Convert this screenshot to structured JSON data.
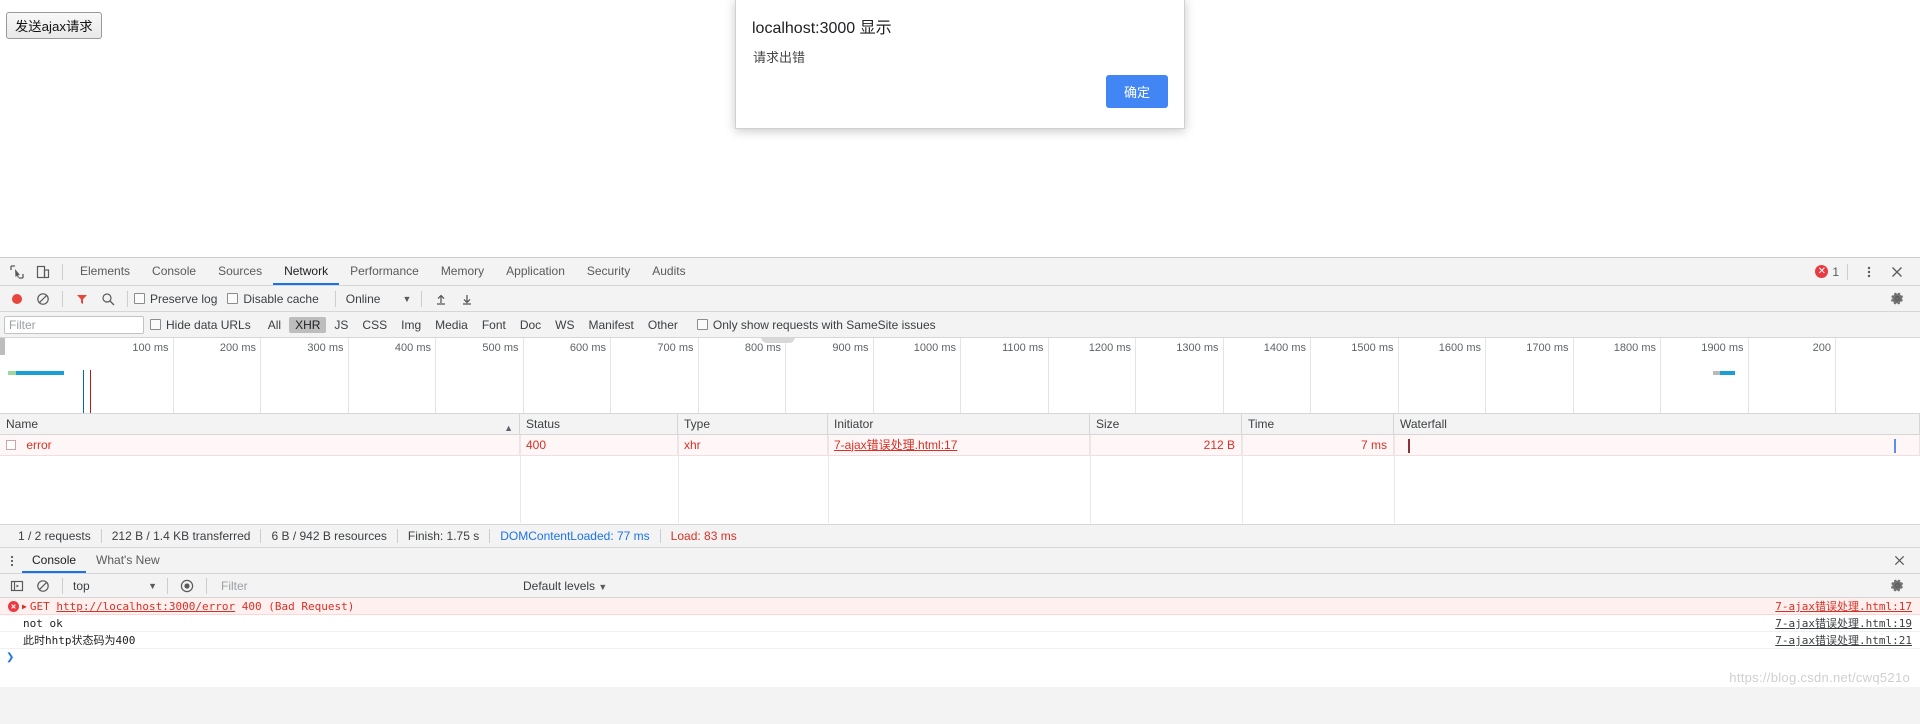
{
  "page": {
    "ajax_button_label": "发送ajax请求"
  },
  "dialog": {
    "origin_title": "localhost:3000 显示",
    "message": "请求出错",
    "ok_label": "确定",
    "accent": "#4285f4"
  },
  "devtools": {
    "tabs": [
      {
        "label": "Elements",
        "active": false
      },
      {
        "label": "Console",
        "active": false
      },
      {
        "label": "Sources",
        "active": false
      },
      {
        "label": "Network",
        "active": true
      },
      {
        "label": "Performance",
        "active": false
      },
      {
        "label": "Memory",
        "active": false
      },
      {
        "label": "Application",
        "active": false
      },
      {
        "label": "Security",
        "active": false
      },
      {
        "label": "Audits",
        "active": false
      }
    ],
    "error_count": "1",
    "icons": [
      "inspect-element-icon",
      "device-toolbar-icon",
      "more-options-icon",
      "close-icon"
    ]
  },
  "network_controls": {
    "preserve_log_label": "Preserve log",
    "preserve_log_checked": false,
    "disable_cache_label": "Disable cache",
    "disable_cache_checked": false,
    "throttling_value": "Online",
    "icons": [
      "record-icon",
      "clear-icon",
      "filter-icon",
      "search-icon",
      "import-har-icon",
      "export-har-icon",
      "settings-gear-icon"
    ]
  },
  "network_filter": {
    "filter_placeholder": "Filter",
    "filter_value": "",
    "hide_data_urls_label": "Hide data URLs",
    "hide_data_urls_checked": false,
    "type_chips": [
      {
        "label": "All",
        "active": false
      },
      {
        "label": "XHR",
        "active": true
      },
      {
        "label": "JS",
        "active": false
      },
      {
        "label": "CSS",
        "active": false
      },
      {
        "label": "Img",
        "active": false
      },
      {
        "label": "Media",
        "active": false
      },
      {
        "label": "Font",
        "active": false
      },
      {
        "label": "Doc",
        "active": false
      },
      {
        "label": "WS",
        "active": false
      },
      {
        "label": "Manifest",
        "active": false
      },
      {
        "label": "Other",
        "active": false
      }
    ],
    "samesite_label": "Only show requests with SameSite issues",
    "samesite_checked": false
  },
  "timeline": {
    "ticks": [
      "100 ms",
      "200 ms",
      "300 ms",
      "400 ms",
      "500 ms",
      "600 ms",
      "700 ms",
      "800 ms",
      "900 ms",
      "1000 ms",
      "1100 ms",
      "1200 ms",
      "1300 ms",
      "1400 ms",
      "1500 ms",
      "1600 ms",
      "1700 ms",
      "1800 ms",
      "1900 ms",
      "200"
    ],
    "dom_content_loaded_color": "#0b5fc4",
    "load_color": "#b71c1c",
    "bar_color": "#1a9fd4"
  },
  "request_table": {
    "columns": [
      {
        "label": "Name",
        "sorted": "asc"
      },
      {
        "label": "Status",
        "sorted": ""
      },
      {
        "label": "Type",
        "sorted": ""
      },
      {
        "label": "Initiator",
        "sorted": ""
      },
      {
        "label": "Size",
        "sorted": ""
      },
      {
        "label": "Time",
        "sorted": ""
      },
      {
        "label": "Waterfall",
        "sorted": ""
      }
    ],
    "rows": [
      {
        "name": "error",
        "status": "400",
        "type": "xhr",
        "initiator": "7-ajax错误处理.html:17",
        "size": "212 B",
        "time": "7 ms"
      }
    ],
    "error_color": "#d93025"
  },
  "network_summary": {
    "requests": "1 / 2 requests",
    "transferred": "212 B / 1.4 KB transferred",
    "resources": "6 B / 942 B resources",
    "finish": "Finish: 1.75 s",
    "dom_content_loaded": "DOMContentLoaded: 77 ms",
    "load": "Load: 83 ms"
  },
  "drawer": {
    "tabs": [
      {
        "label": "Console",
        "active": true
      },
      {
        "label": "What's New",
        "active": false
      }
    ],
    "icons": [
      "more-options-icon",
      "close-icon"
    ]
  },
  "console_controls": {
    "context_value": "top",
    "filter_placeholder": "Filter",
    "filter_value": "",
    "levels_label": "Default levels",
    "icons": [
      "console-sidebar-icon",
      "clear-console-icon",
      "live-expression-icon",
      "settings-gear-icon"
    ]
  },
  "console_messages": [
    {
      "kind": "error",
      "icon": "error-circle-icon",
      "expandable": true,
      "text_prefix": "GET ",
      "link": "http://localhost:3000/error",
      "text_suffix": " 400 (Bad Request)",
      "source": "7-ajax错误处理.html:17"
    },
    {
      "kind": "log",
      "icon": "",
      "expandable": false,
      "text_prefix": "not ok",
      "link": "",
      "text_suffix": "",
      "source": "7-ajax错误处理.html:19"
    },
    {
      "kind": "log",
      "icon": "",
      "expandable": false,
      "text_prefix": "此时hhtp状态码为400",
      "link": "",
      "text_suffix": "",
      "source": "7-ajax错误处理.html:21"
    }
  ],
  "console_prompt": {
    "caret": "❯"
  },
  "watermark": {
    "text": "https://blog.csdn.net/cwq521o"
  }
}
